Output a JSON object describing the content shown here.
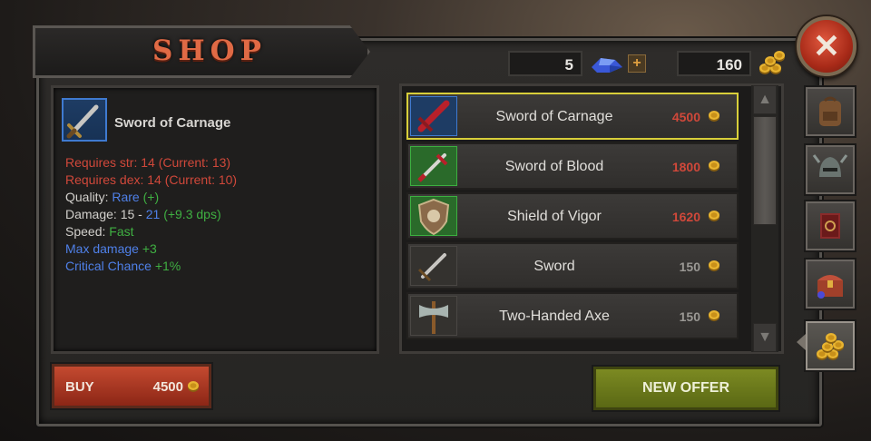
{
  "header": {
    "title": "SHOP"
  },
  "currency": {
    "gems": "5",
    "gem_icon": "blue-gem-icon",
    "add_gems_label": "+",
    "gold": "160",
    "gold_icon": "gold-coins-icon"
  },
  "close_label": "✕",
  "selected_item": {
    "name": "Sword of Carnage",
    "stats": {
      "str": "Requires str: 14 (Current: 13)",
      "dex": "Requires dex: 14 (Current: 10)",
      "quality_label": "Quality: ",
      "quality_value": "Rare",
      "quality_plus": "(+)",
      "damage_label": "Damage: 15 - ",
      "damage_max": "21",
      "damage_dps": "(+9.3 dps)",
      "speed_label": "Speed: ",
      "speed_value": "Fast",
      "maxdmg_label": "Max damage ",
      "maxdmg_value": "+3",
      "crit_label": "Critical Chance ",
      "crit_value": "+1%"
    }
  },
  "buy": {
    "label": "BUY",
    "price": "4500"
  },
  "items": [
    {
      "name": "Sword of Carnage",
      "price": "4500",
      "price_color": "#d0483a",
      "icon": "red-sword-icon"
    },
    {
      "name": "Sword of Blood",
      "price": "1800",
      "price_color": "#d0483a",
      "icon": "blood-sword-icon"
    },
    {
      "name": "Shield of Vigor",
      "price": "1620",
      "price_color": "#d0483a",
      "icon": "shield-icon"
    },
    {
      "name": "Sword",
      "price": "150",
      "price_color": "#9a9894",
      "icon": "sword-icon"
    },
    {
      "name": "Two-Handed Axe",
      "price": "150",
      "price_color": "#9a9894",
      "icon": "axe-icon"
    }
  ],
  "tabs": [
    "backpack-icon",
    "helmet-icon",
    "spellbook-icon",
    "treasure-chest-icon",
    "gold-pile-icon"
  ],
  "new_offer_label": "NEW OFFER",
  "colors": {
    "accent": "#e06a45",
    "selected_border": "#d8cf3a",
    "buy": "#c44a30",
    "new_offer": "#7c8a22"
  }
}
